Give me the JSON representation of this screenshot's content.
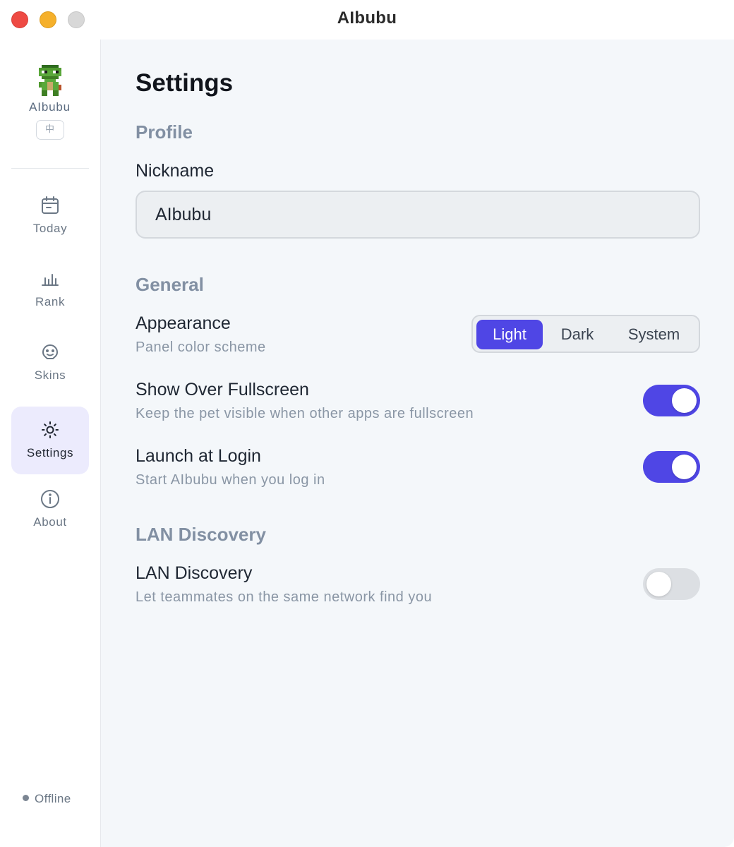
{
  "window": {
    "title": "AIbubu"
  },
  "sidebar": {
    "brand_name": "AIbubu",
    "language_badge": "中",
    "items": [
      {
        "label": "Today",
        "icon": "calendar-icon",
        "active": false
      },
      {
        "label": "Rank",
        "icon": "bar-chart-icon",
        "active": false
      },
      {
        "label": "Skins",
        "icon": "smiley-icon",
        "active": false
      },
      {
        "label": "Settings",
        "icon": "sun-gear-icon",
        "active": true
      },
      {
        "label": "About",
        "icon": "info-icon",
        "active": false
      }
    ],
    "status": "Offline"
  },
  "settings": {
    "title": "Settings",
    "profile": {
      "section_title": "Profile",
      "nickname_label": "Nickname",
      "nickname_value": "AIbubu"
    },
    "general": {
      "section_title": "General",
      "appearance": {
        "label": "Appearance",
        "description": "Panel color scheme",
        "options": [
          "Light",
          "Dark",
          "System"
        ],
        "selected": "Light"
      },
      "show_over_fullscreen": {
        "label": "Show Over Fullscreen",
        "description": "Keep the pet visible when other apps are fullscreen",
        "enabled": true
      },
      "launch_at_login": {
        "label": "Launch at Login",
        "description": "Start AIbubu when you log in",
        "enabled": true
      }
    },
    "lan": {
      "section_title": "LAN Discovery",
      "lan_discovery": {
        "label": "LAN Discovery",
        "description": "Let teammates on the same network find you",
        "enabled": false
      }
    }
  },
  "colors": {
    "accent": "#4f46e5",
    "sidebar_active_bg": "#ecebfd",
    "main_bg": "#f4f7fa",
    "section_title": "#8290a3",
    "toggle_off": "#dcdfe3"
  }
}
